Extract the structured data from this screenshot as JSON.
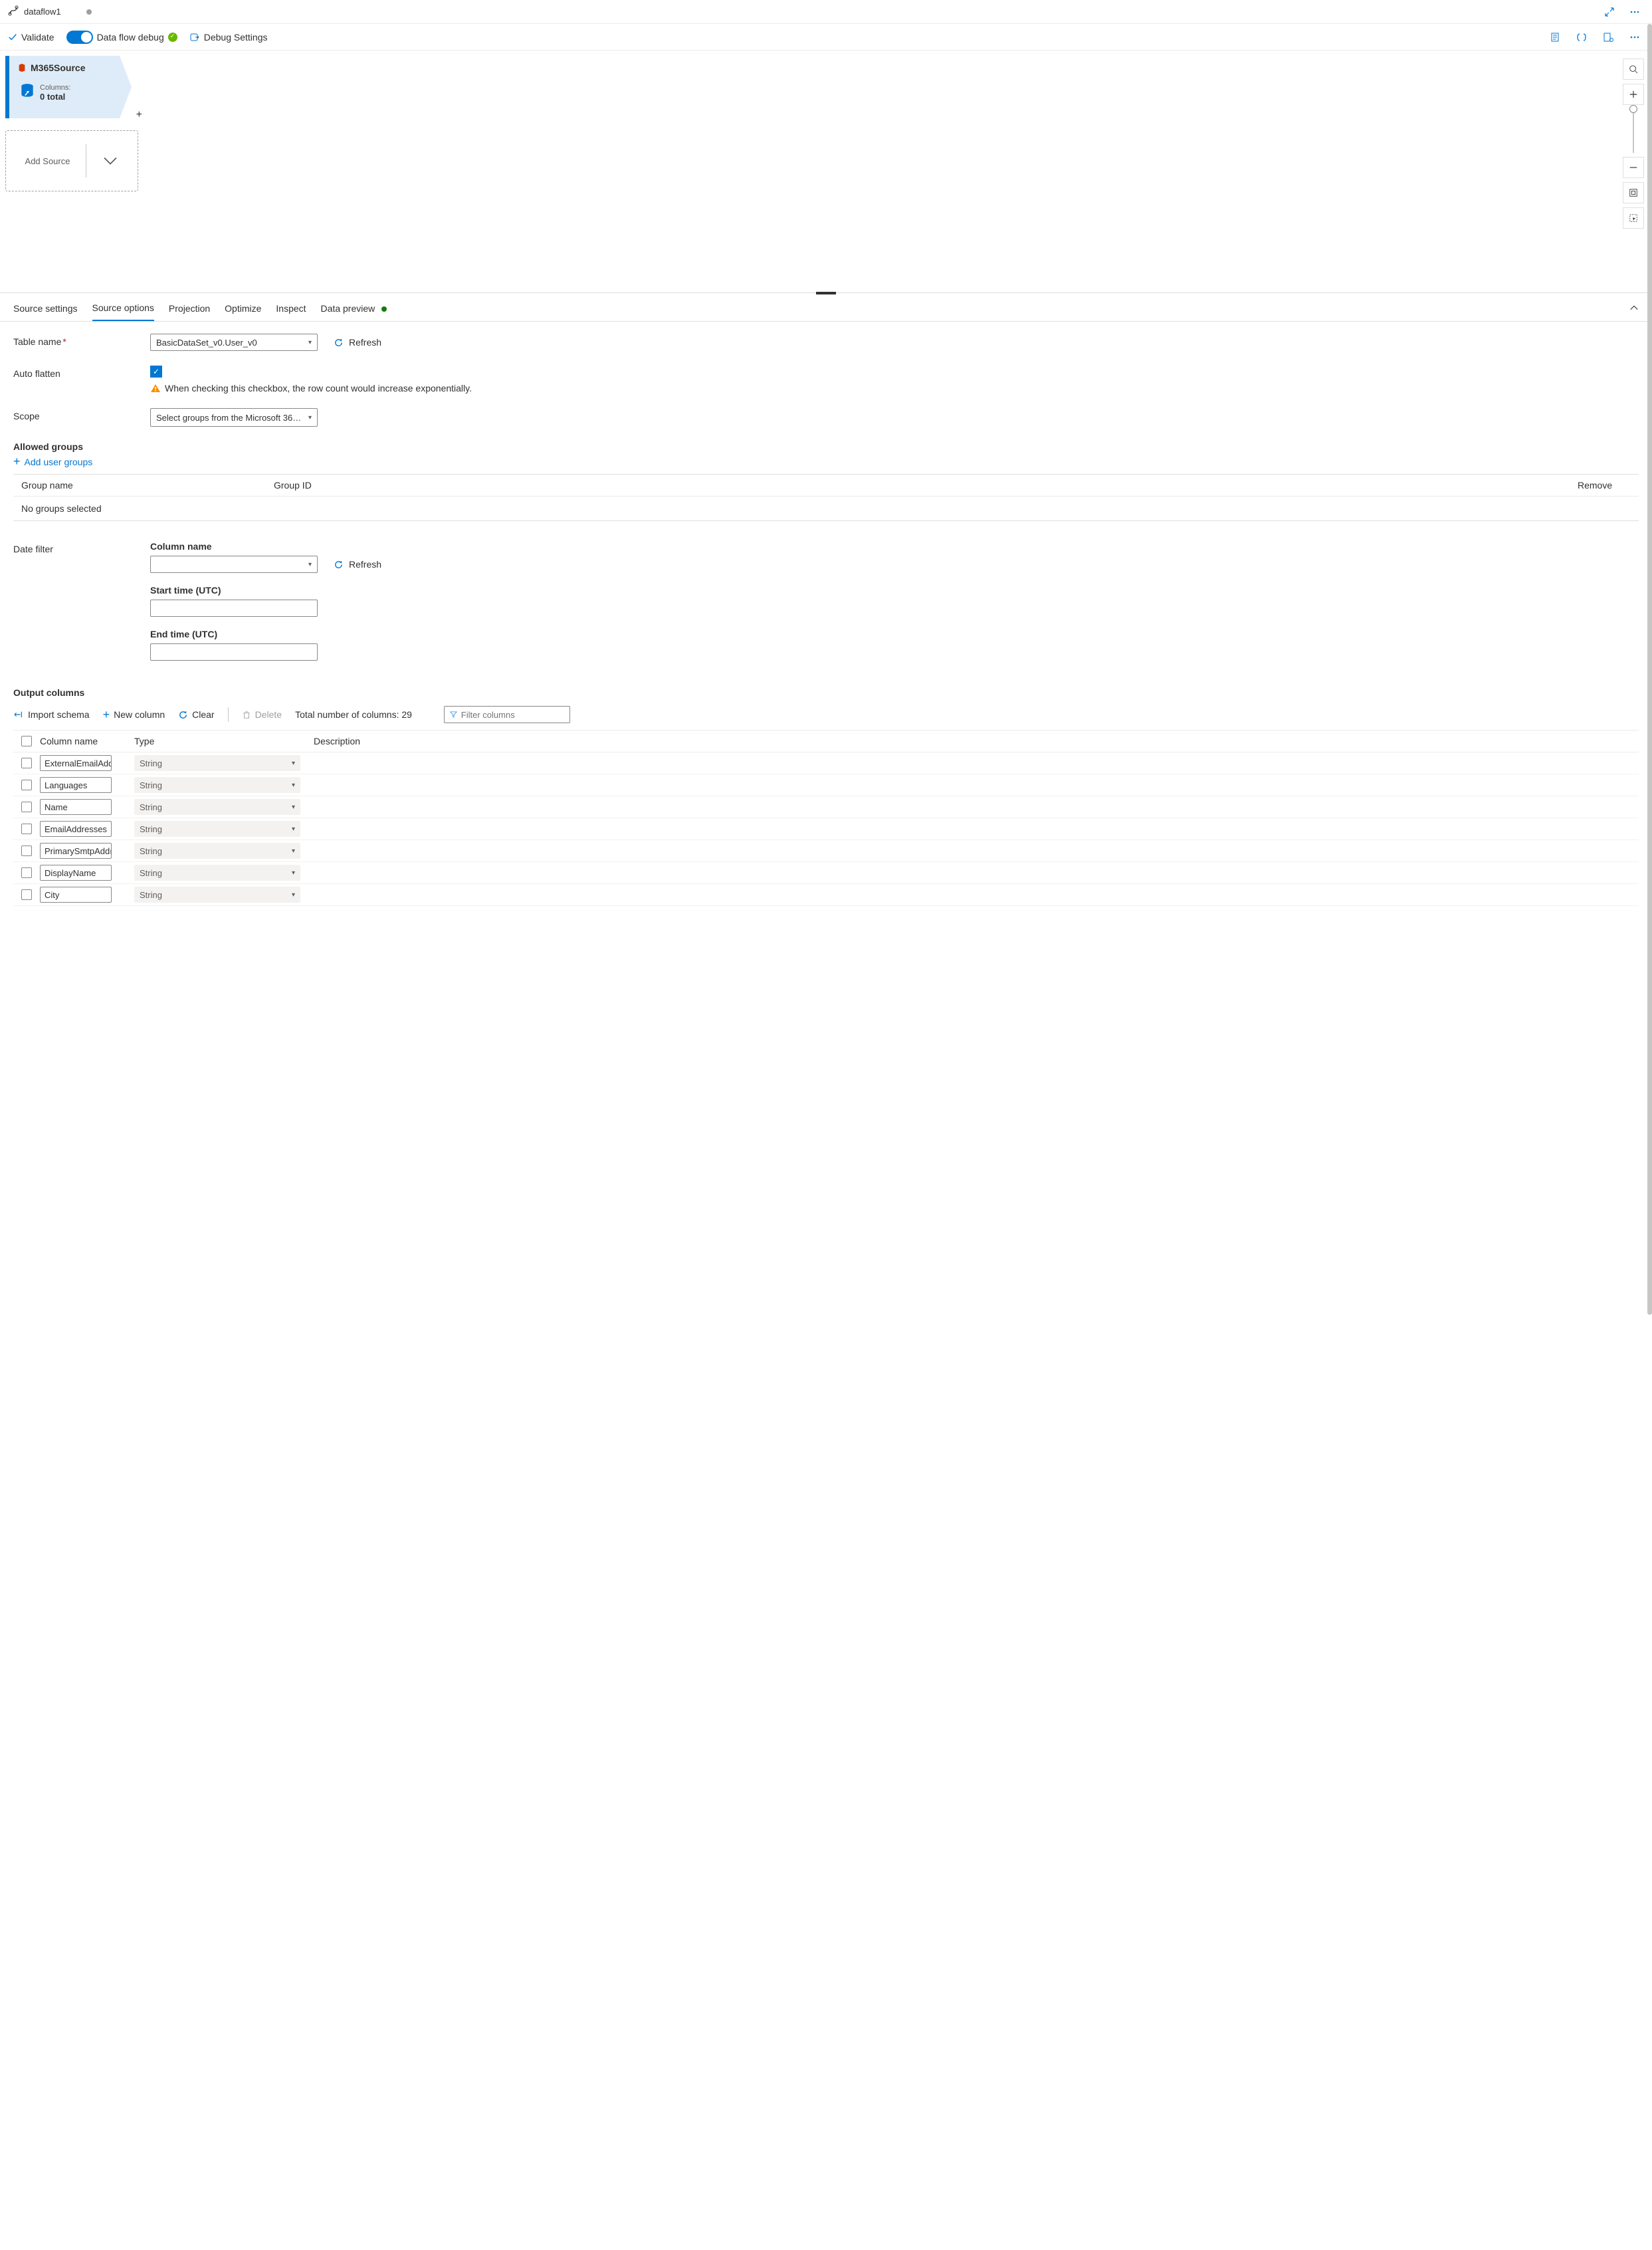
{
  "tab": {
    "title": "dataflow1"
  },
  "toolbar": {
    "validate": "Validate",
    "debug_label": "Data flow debug",
    "debug_settings": "Debug Settings"
  },
  "node": {
    "title": "M365Source",
    "columns_label": "Columns:",
    "columns_count": "0 total"
  },
  "add_source": "Add Source",
  "panel_tabs": {
    "t1": "Source settings",
    "t2": "Source options",
    "t3": "Projection",
    "t4": "Optimize",
    "t5": "Inspect",
    "t6": "Data preview"
  },
  "form": {
    "table_name_label": "Table name",
    "table_name_value": "BasicDataSet_v0.User_v0",
    "refresh": "Refresh",
    "auto_flatten_label": "Auto flatten",
    "auto_flatten_warn": "When checking this checkbox, the row count would increase exponentially.",
    "scope_label": "Scope",
    "scope_value": "Select groups from the Microsoft 36…",
    "allowed_groups": "Allowed groups",
    "add_user_groups": "Add user groups",
    "group_name_h": "Group name",
    "group_id_h": "Group ID",
    "remove_h": "Remove",
    "no_groups": "No groups selected",
    "date_filter_label": "Date filter",
    "column_name_label": "Column name",
    "start_time_label": "Start time (UTC)",
    "end_time_label": "End time (UTC)",
    "output_columns": "Output columns",
    "import_schema": "Import schema",
    "new_column": "New column",
    "clear": "Clear",
    "delete": "Delete",
    "total_columns": "Total number of columns: 29",
    "filter_placeholder": "Filter columns",
    "col_name_h": "Column name",
    "col_type_h": "Type",
    "col_desc_h": "Description"
  },
  "columns": [
    {
      "name": "ExternalEmailAdd",
      "type": "String"
    },
    {
      "name": "Languages",
      "type": "String"
    },
    {
      "name": "Name",
      "type": "String"
    },
    {
      "name": "EmailAddresses",
      "type": "String"
    },
    {
      "name": "PrimarySmtpAddı",
      "type": "String"
    },
    {
      "name": "DisplayName",
      "type": "String"
    },
    {
      "name": "City",
      "type": "String"
    }
  ]
}
